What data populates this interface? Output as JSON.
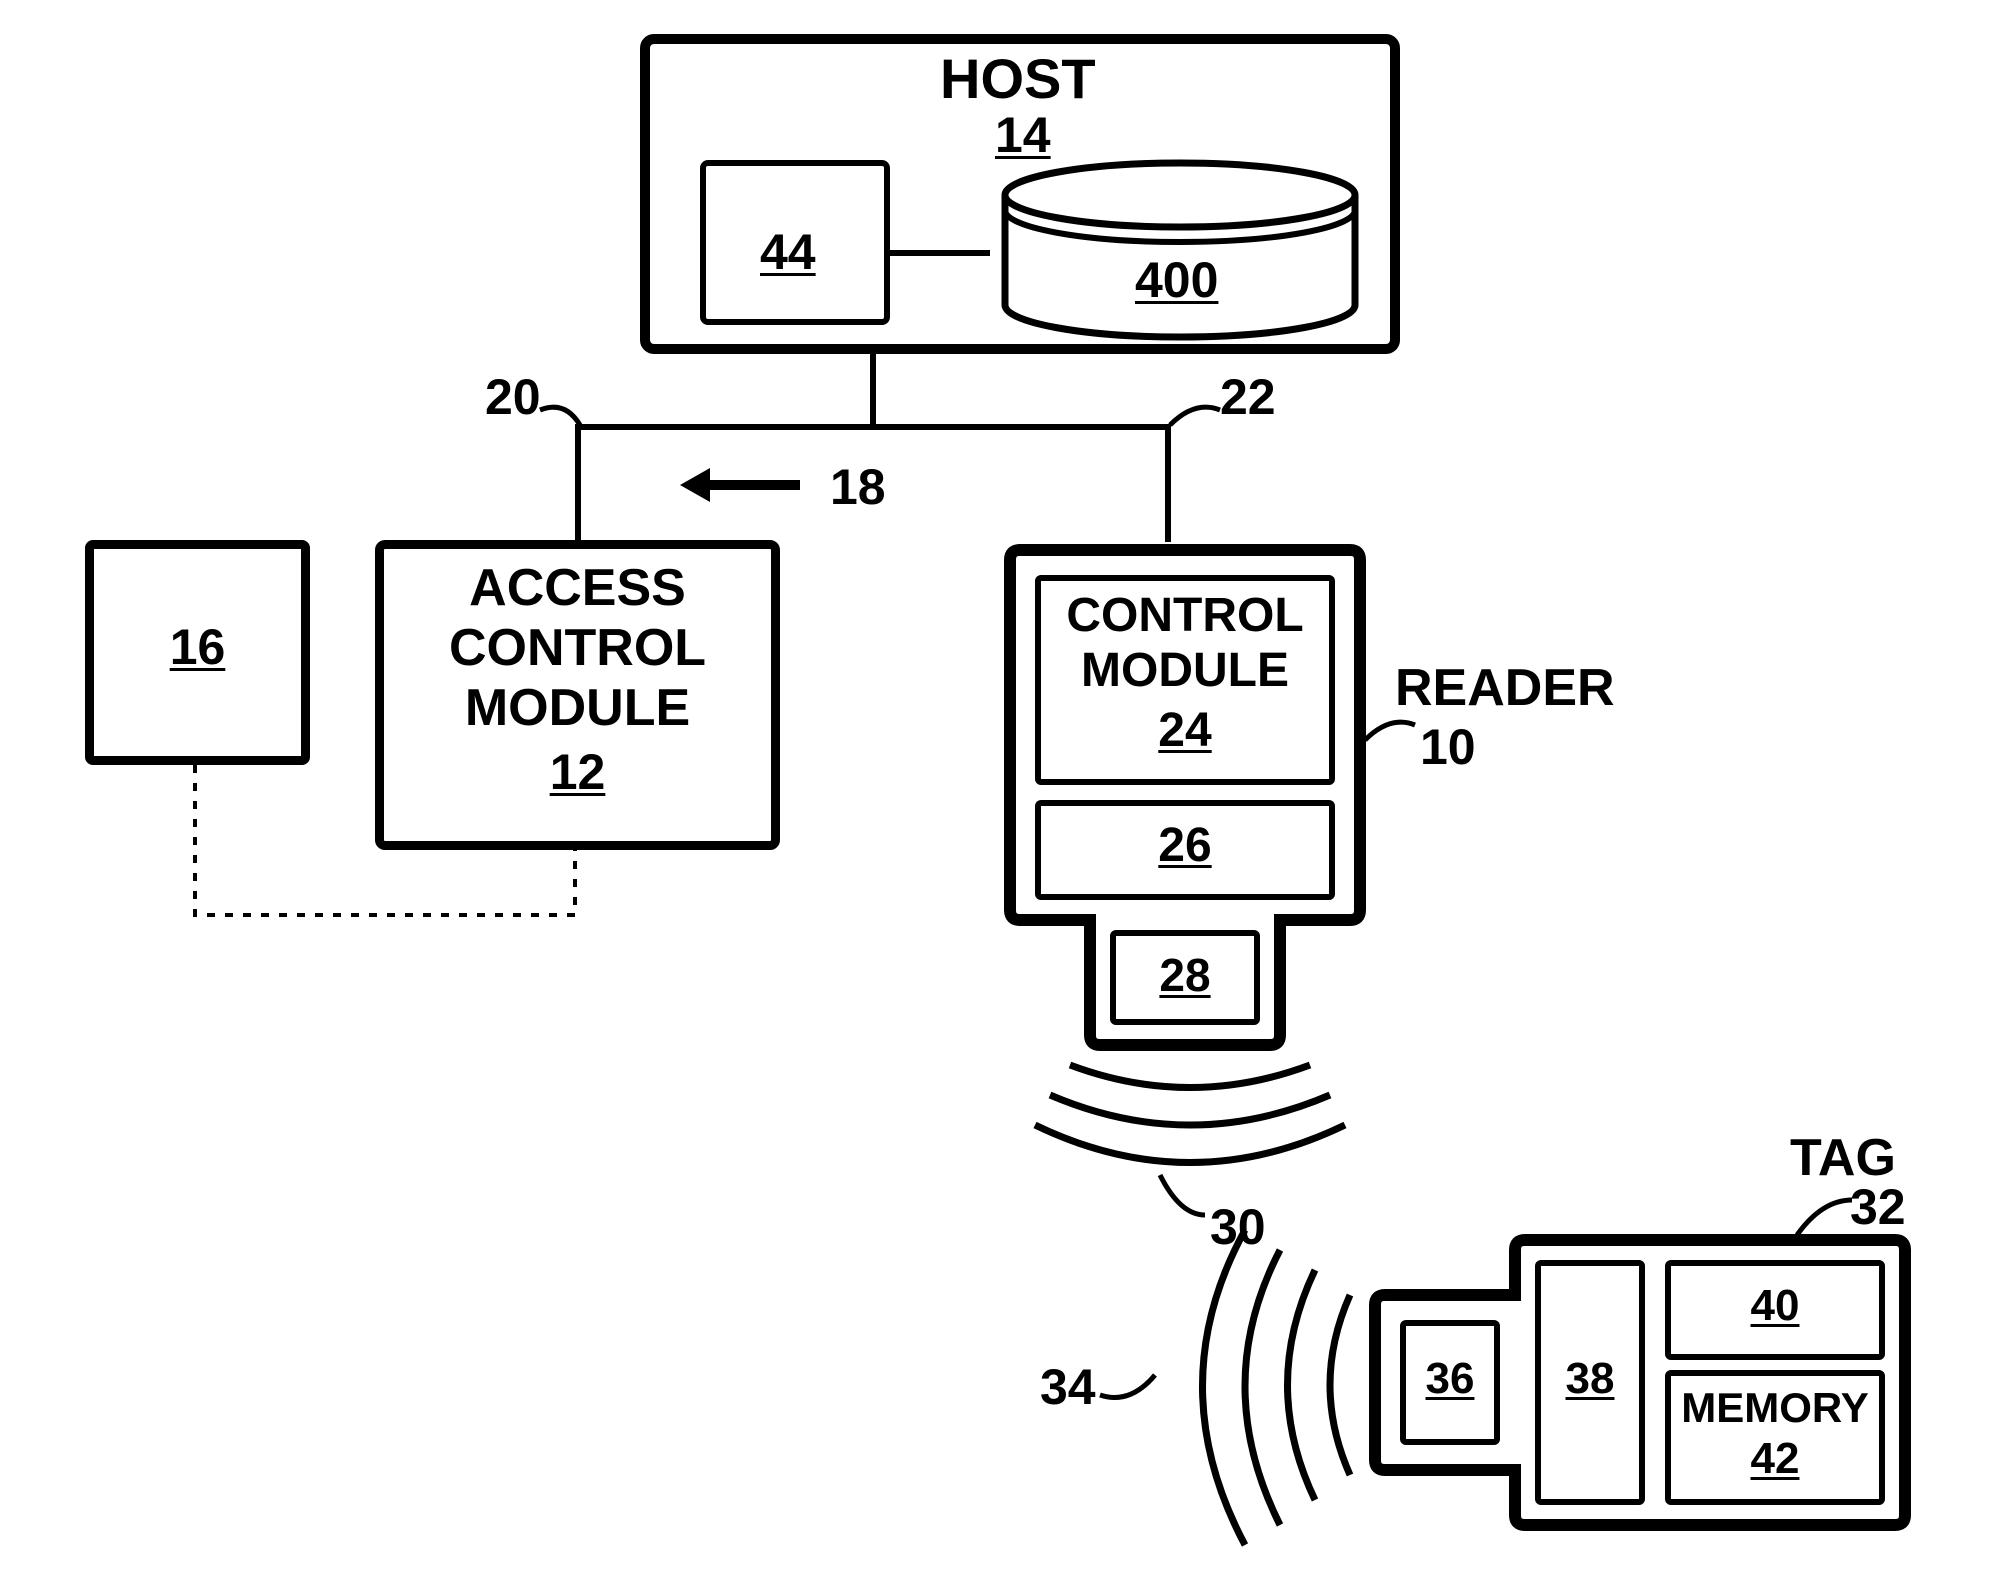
{
  "host": {
    "title": "HOST",
    "ref": "14",
    "block44": "44",
    "db": "400"
  },
  "acm": {
    "title_line1": "ACCESS",
    "title_line2": "CONTROL",
    "title_line3": "MODULE",
    "ref": "12"
  },
  "block16": {
    "ref": "16"
  },
  "reader": {
    "outside_label": "READER",
    "outside_ref": "10",
    "cm_line1": "CONTROL",
    "cm_line2": "MODULE",
    "cm_ref": "24",
    "block26": "26",
    "block28": "28"
  },
  "tag": {
    "outside_label": "TAG",
    "outside_ref": "32",
    "block36": "36",
    "block38": "38",
    "block40": "40",
    "mem_label": "MEMORY",
    "mem_ref": "42"
  },
  "refs": {
    "r20": "20",
    "r22": "22",
    "r18": "18",
    "r30": "30",
    "r34": "34"
  }
}
